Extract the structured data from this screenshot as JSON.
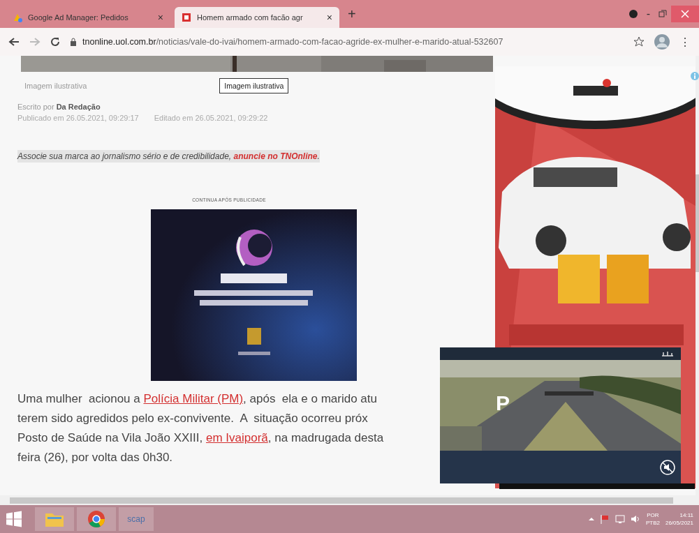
{
  "tabs": [
    {
      "label": "Google Ad Manager: Pedidos",
      "selected": false,
      "close": "×"
    },
    {
      "label": "Homem armado com facão agr",
      "selected": true,
      "close": "×"
    }
  ],
  "new_tab": "+",
  "window_controls": {
    "minimize": "-"
  },
  "address_bar": {
    "domain": "tnonline.uol.com.br",
    "path": "/noticias/vale-do-ivai/homem-armado-com-facao-agride-ex-mulher-e-marido-atual-532607",
    "menu": "⋮"
  },
  "article": {
    "caption": "Imagem ilustrativa",
    "tooltip": "Imagem ilustrativa",
    "byline": "Escrito por **Da Redação**",
    "published": "Publicado em 26.05.2021, 09:29:17",
    "edited": "Editado em 26.05.2021, 09:29:22",
    "promo": {
      "text": "Associe sua marca ao jornalismo sério e de credibilidade, ",
      "link": "anuncie no TNOnline",
      "end": "."
    },
    "ad_label": "CONTINUA APÓS PUBLICIDADE",
    "paragraph_lines": [
      [
        {
          "text": "Uma mulher  acionou a ",
          "link": false
        },
        {
          "text": "Polícia Militar (PM)",
          "link": true
        },
        {
          "text": ", após  ela e o marido atu",
          "link": false
        }
      ],
      [
        {
          "text": "terem sido agredidos pelo ex-convivente.  A  situação ocorreu próx",
          "link": false
        }
      ],
      [
        {
          "text": "Posto de Saúde na Vila João XXIII, ",
          "link": false
        },
        {
          "text": "em Ivaiporã",
          "link": true
        },
        {
          "text": ", na madrugada desta",
          "link": false
        }
      ],
      [
        {
          "text": "feira (26), por volta das 0h30.",
          "link": false
        }
      ]
    ]
  },
  "video": {
    "overlay_letter": "P"
  },
  "taskbar": {
    "apps": [
      {
        "kind": "folder"
      },
      {
        "kind": "chrome"
      },
      {
        "kind": "text",
        "label": "scap"
      }
    ],
    "tray": {
      "language": "POR",
      "layout": "PTB2",
      "time": "14:11",
      "date": "26/05/2021"
    }
  }
}
